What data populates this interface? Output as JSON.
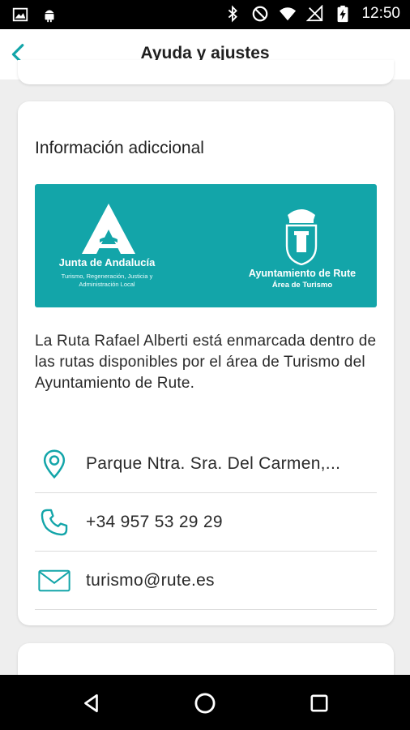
{
  "status_bar": {
    "time": "12:50",
    "icons": [
      "image-icon",
      "android-icon",
      "bluetooth-icon",
      "do-not-disturb-icon",
      "wifi-icon",
      "no-signal-icon",
      "battery-charging-icon"
    ]
  },
  "app_bar": {
    "title": "Ayuda y ajustes",
    "back_icon": "chevron-left-icon"
  },
  "info_card": {
    "heading": "Información adiccional",
    "banner": {
      "background": "#13a5a9",
      "junta_name": "Junta de Andalucía",
      "junta_sub_line1": "Turismo, Regeneración, Justicia y",
      "junta_sub_line2": "Administración Local",
      "ayto_name": "Ayuntamiento de Rute",
      "ayto_sub": "Área de Turismo"
    },
    "description": "La Ruta Rafael Alberti está enmarcada dentro de las rutas disponibles por el área de Turismo del Ayuntamiento de Rute.",
    "contacts": [
      {
        "icon": "location-pin-icon",
        "text": "Parque Ntra. Sra. Del Carmen,..."
      },
      {
        "icon": "phone-icon",
        "text": "+34 957 53 29 29"
      },
      {
        "icon": "mail-icon",
        "text": "turismo@rute.es"
      }
    ]
  },
  "colors": {
    "accent": "#13a5a9",
    "background": "#eeeeee",
    "card": "#ffffff"
  },
  "nav_bar": {
    "buttons": [
      "back-triangle-icon",
      "home-circle-icon",
      "recents-square-icon"
    ]
  }
}
